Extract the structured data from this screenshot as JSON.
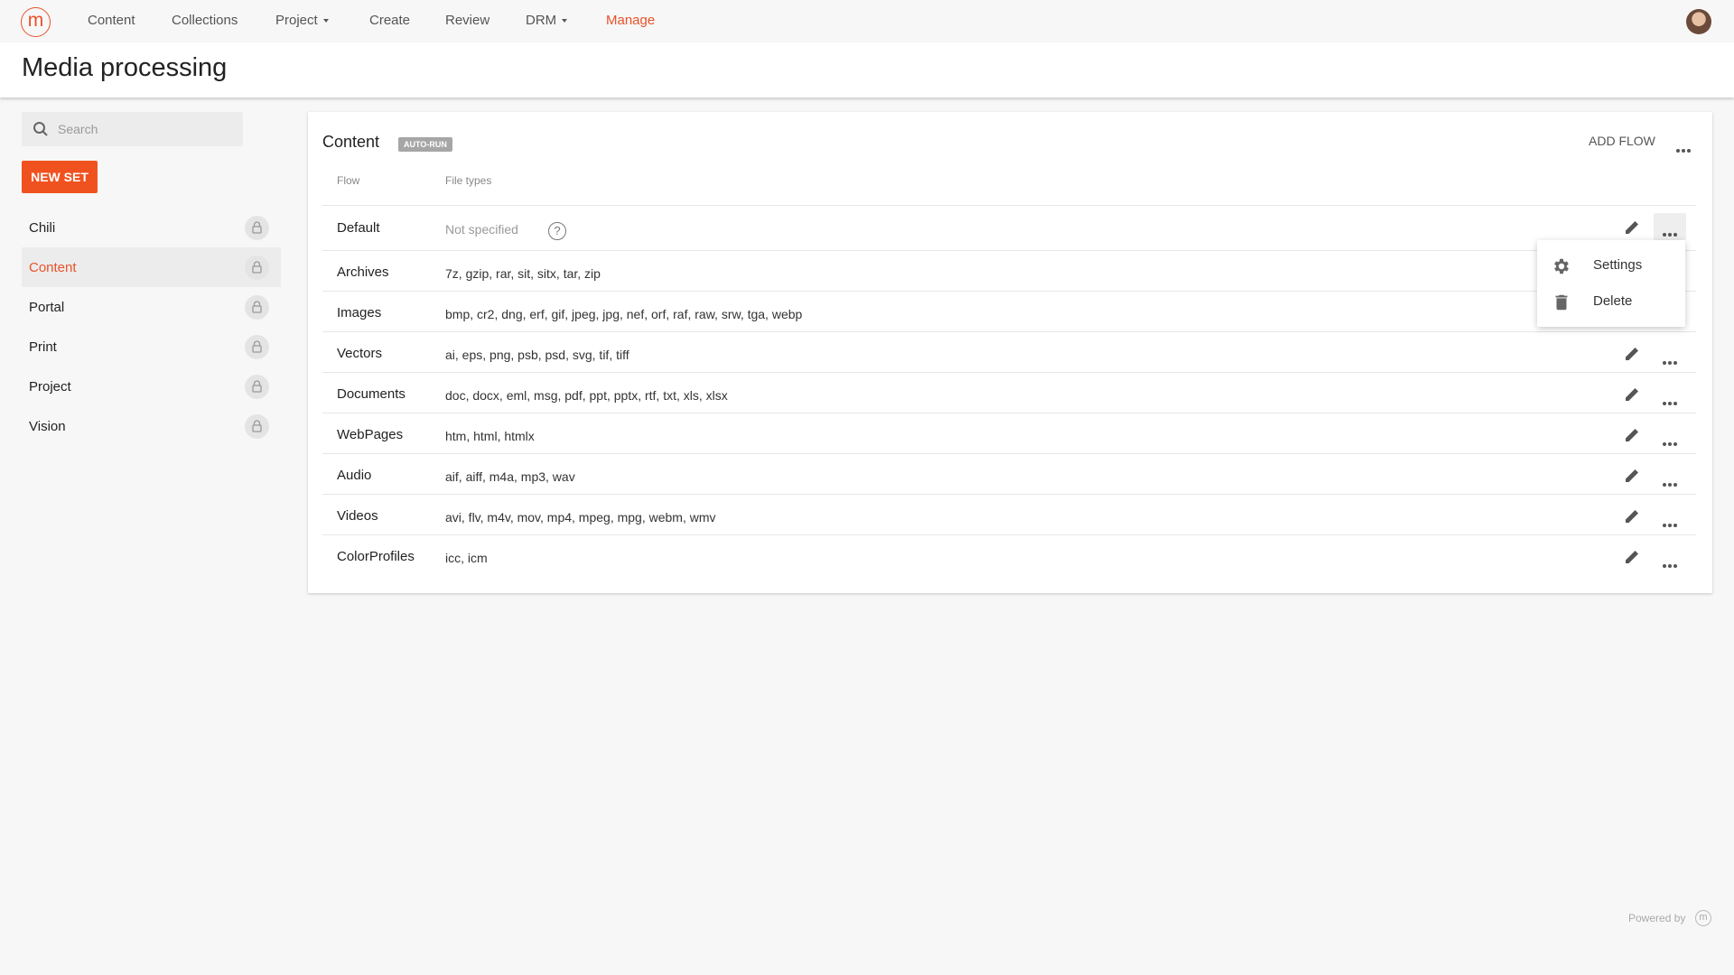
{
  "nav": {
    "logo_letter": "m",
    "items": [
      {
        "label": "Content"
      },
      {
        "label": "Collections"
      },
      {
        "label": "Project"
      },
      {
        "label": "Create"
      },
      {
        "label": "Review"
      },
      {
        "label": "DRM"
      },
      {
        "label": "Manage"
      }
    ],
    "accent_color": "#e8522a"
  },
  "page": {
    "title": "Media processing"
  },
  "sidebar": {
    "search_placeholder": "Search",
    "new_set_label": "NEW SET",
    "sets": [
      {
        "label": "Chili"
      },
      {
        "label": "Content"
      },
      {
        "label": "Portal"
      },
      {
        "label": "Print"
      },
      {
        "label": "Project"
      },
      {
        "label": "Vision"
      }
    ],
    "selected_set": "Content"
  },
  "card": {
    "title": "Content",
    "badge": "AUTO-RUN",
    "add_flow_label": "ADD FLOW",
    "columns": [
      "Flow",
      "File types"
    ],
    "rows": [
      {
        "flow": "Default",
        "file_types": "Not specified"
      },
      {
        "flow": "Archives",
        "file_types": "7z, gzip, rar, sit, sitx, tar, zip"
      },
      {
        "flow": "Images",
        "file_types": "bmp, cr2, dng, erf, gif, jpeg, jpg, nef, orf, raf, raw, srw, tga, webp"
      },
      {
        "flow": "Vectors",
        "file_types": "ai, eps, png, psb, psd, svg, tif, tiff"
      },
      {
        "flow": "Documents",
        "file_types": "doc, docx, eml, msg, pdf, ppt, pptx, rtf, txt, xls, xlsx"
      },
      {
        "flow": "WebPages",
        "file_types": "htm, html, htmlx"
      },
      {
        "flow": "Audio",
        "file_types": "aif, aiff, m4a, mp3, wav"
      },
      {
        "flow": "Videos",
        "file_types": "avi, flv, m4v, mov, mp4, mpeg, mpg, webm, wmv"
      },
      {
        "flow": "ColorProfiles",
        "file_types": "icc, icm"
      }
    ]
  },
  "menu": {
    "items": [
      {
        "label": "Settings",
        "icon": "gear-icon"
      },
      {
        "label": "Delete",
        "icon": "trash-icon"
      }
    ]
  },
  "footer": {
    "powered_by": "Powered by",
    "logo_letter": "m"
  }
}
